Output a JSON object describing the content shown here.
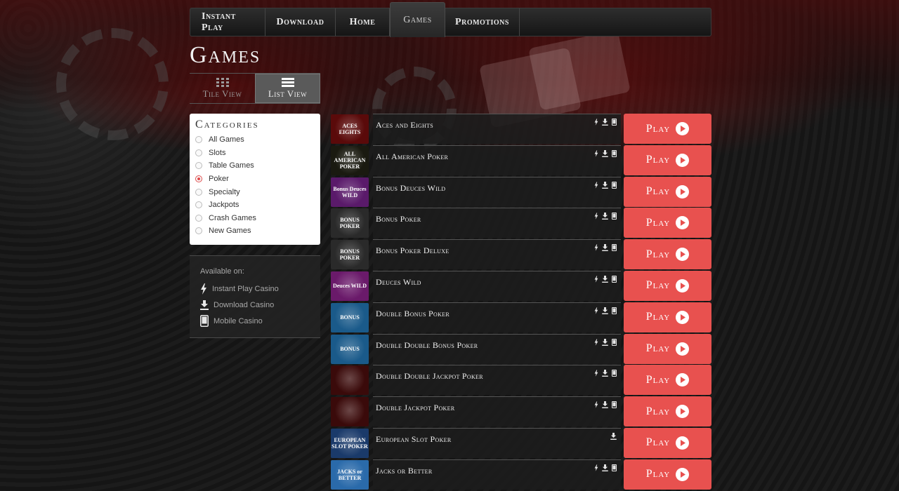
{
  "nav": {
    "items": [
      {
        "label": "Instant Play"
      },
      {
        "label": "Download"
      },
      {
        "label": "Home"
      },
      {
        "label": "Games"
      },
      {
        "label": "Promotions"
      }
    ]
  },
  "page_title": "Games",
  "view_toggle": {
    "tile_label": "Tile View",
    "list_label": "List View",
    "active": "list"
  },
  "categories": {
    "title": "Categories",
    "selected": "Poker",
    "items": [
      {
        "label": "All Games"
      },
      {
        "label": "Slots"
      },
      {
        "label": "Table Games"
      },
      {
        "label": "Poker"
      },
      {
        "label": "Specialty"
      },
      {
        "label": "Jackpots"
      },
      {
        "label": "Crash Games"
      },
      {
        "label": "New Games"
      }
    ]
  },
  "available_on": {
    "heading": "Available on:",
    "items": [
      {
        "label": "Instant Play Casino",
        "icon": "lightning-icon"
      },
      {
        "label": "Download Casino",
        "icon": "download-icon"
      },
      {
        "label": "Mobile Casino",
        "icon": "mobile-icon"
      }
    ]
  },
  "play_label": "Play",
  "colors": {
    "play_button": "#e8514f",
    "accent_radio": "#e04a4a"
  },
  "games": [
    {
      "name": "Aces and Eights",
      "thumb_text": "ACES EIGHTS",
      "thumb_bg": "#5a0a0a",
      "platforms": [
        "instant",
        "download",
        "mobile"
      ]
    },
    {
      "name": "All American Poker",
      "thumb_text": "ALL AMERICAN POKER",
      "thumb_bg": "#1a1a10",
      "platforms": [
        "instant",
        "download",
        "mobile"
      ]
    },
    {
      "name": "Bonus Deuces Wild",
      "thumb_text": "Bonus Deuces WILD",
      "thumb_bg": "#5a1a6a",
      "platforms": [
        "instant",
        "download",
        "mobile"
      ]
    },
    {
      "name": "Bonus Poker",
      "thumb_text": "BONUS POKER",
      "thumb_bg": "#2a2a2a",
      "platforms": [
        "instant",
        "download",
        "mobile"
      ]
    },
    {
      "name": "Bonus Poker Deluxe",
      "thumb_text": "BONUS POKER",
      "thumb_bg": "#2a2a2a",
      "platforms": [
        "instant",
        "download",
        "mobile"
      ]
    },
    {
      "name": "Deuces Wild",
      "thumb_text": "Deuces WILD",
      "thumb_bg": "#6a1a6a",
      "platforms": [
        "instant",
        "download",
        "mobile"
      ]
    },
    {
      "name": "Double Bonus Poker",
      "thumb_text": "BONUS",
      "thumb_bg": "#1a5a8a",
      "platforms": [
        "instant",
        "download",
        "mobile"
      ]
    },
    {
      "name": "Double Double Bonus Poker",
      "thumb_text": "BONUS",
      "thumb_bg": "#1a5a8a",
      "platforms": [
        "instant",
        "download",
        "mobile"
      ]
    },
    {
      "name": "Double Double Jackpot Poker",
      "thumb_text": "",
      "thumb_bg": "#3a0a0a",
      "platforms": [
        "instant",
        "download",
        "mobile"
      ]
    },
    {
      "name": "Double Jackpot Poker",
      "thumb_text": "",
      "thumb_bg": "#3a0a0a",
      "platforms": [
        "instant",
        "download",
        "mobile"
      ]
    },
    {
      "name": "European Slot Poker",
      "thumb_text": "EUROPEAN SLOT POKER",
      "thumb_bg": "#1a3a6a",
      "platforms": [
        "download"
      ]
    },
    {
      "name": "Jacks or Better",
      "thumb_text": "JACKS or BETTER",
      "thumb_bg": "#2a6aaa",
      "platforms": [
        "instant",
        "download",
        "mobile"
      ]
    }
  ]
}
